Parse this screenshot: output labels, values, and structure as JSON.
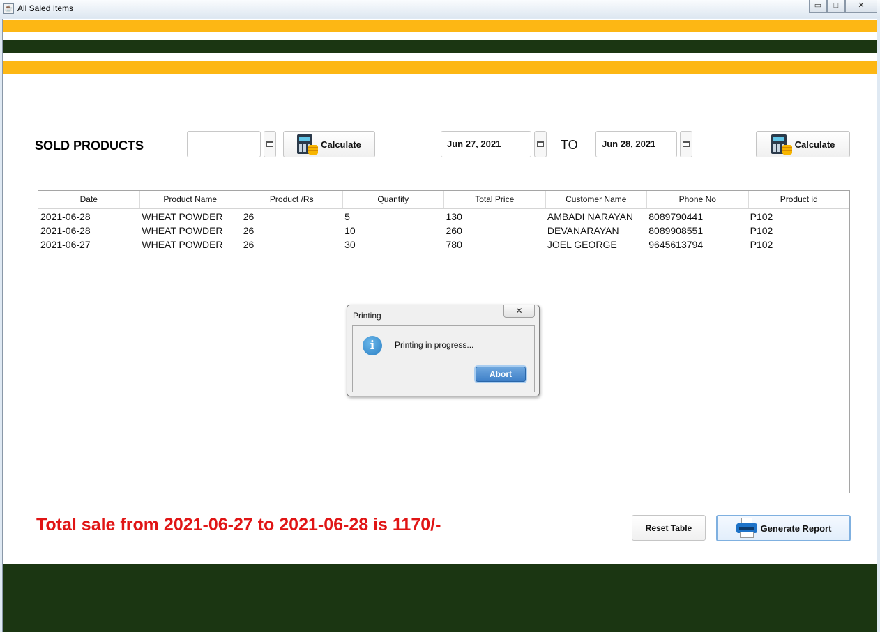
{
  "window": {
    "title": "All Saled Items",
    "min": "▭",
    "max": "□",
    "close": "✕"
  },
  "heading": "SOLD PRODUCTS",
  "filter": {
    "single_date_value": "",
    "calculate_label_1": "Calculate",
    "from_date": "Jun 27, 2021",
    "to_label": "TO",
    "to_date": "Jun 28, 2021",
    "calculate_label_2": "Calculate"
  },
  "table": {
    "columns": [
      "Date",
      "Product Name",
      "Product /Rs",
      "Quantity",
      "Total Price",
      "Customer Name",
      "Phone No",
      "Product id"
    ],
    "rows": [
      [
        "2021-06-28",
        "WHEAT POWDER",
        "26",
        "5",
        "130",
        "AMBADI NARAYAN",
        "8089790441",
        "P102"
      ],
      [
        "2021-06-28",
        "WHEAT POWDER",
        "26",
        "10",
        "260",
        "DEVANARAYAN",
        "8089908551",
        "P102"
      ],
      [
        "2021-06-27",
        "WHEAT POWDER",
        "26",
        "30",
        "780",
        "JOEL GEORGE",
        "9645613794",
        "P102"
      ]
    ]
  },
  "dialog": {
    "title": "Printing",
    "close": "✕",
    "icon_glyph": "i",
    "message": "Printing in progress...",
    "abort_label": "Abort"
  },
  "total_text": "Total sale from 2021-06-27 to 2021-06-28 is 1170/-",
  "reset_label": "Reset Table",
  "generate_label": "Generate Report",
  "colors": {
    "yellow": "#fdb714",
    "dark_green": "#1b3612",
    "total_red": "#e01515",
    "accent_blue": "#3f80c8"
  },
  "icons": [
    "java-icon",
    "calendar-icon",
    "calculator-icon",
    "info-icon",
    "printer-icon"
  ]
}
